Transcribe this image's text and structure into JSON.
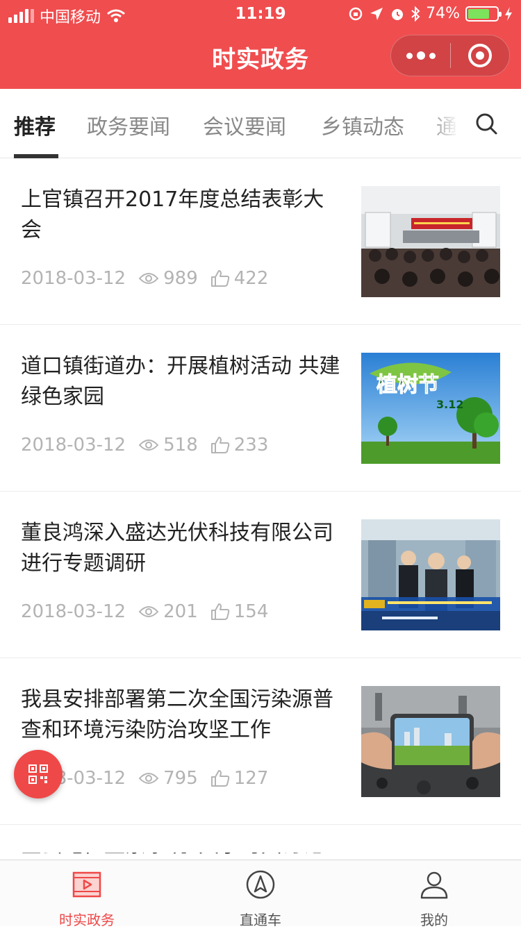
{
  "status": {
    "carrier": "中国移动",
    "time": "11:19",
    "battery": "74%",
    "battery_level": 0.74
  },
  "nav": {
    "title": "时实政务",
    "more_icon": "more-dots-icon",
    "close_icon": "target-close-icon"
  },
  "tabs": [
    {
      "label": "推荐",
      "active": true
    },
    {
      "label": "政务要闻",
      "active": false
    },
    {
      "label": "会议要闻",
      "active": false
    },
    {
      "label": "乡镇动态",
      "active": false
    },
    {
      "label": "通",
      "active": false
    }
  ],
  "news": [
    {
      "title": "上官镇召开2017年度总结表彰大会",
      "date": "2018-03-12",
      "views": "989",
      "likes": "422"
    },
    {
      "title": "道口镇街道办：开展植树活动 共建绿色家园",
      "date": "2018-03-12",
      "views": "518",
      "likes": "233",
      "thumb_text": "植树节",
      "thumb_sub": "3.12"
    },
    {
      "title": "董良鸿深入盛达光伏科技有限公司进行专题调研",
      "date": "2018-03-12",
      "views": "201",
      "likes": "154"
    },
    {
      "title": "我县安排部署第二次全国污染源普查和环境污染防治攻坚工作",
      "date": "2018-03-12",
      "views": "795",
      "likes": "127"
    }
  ],
  "peek_title": "全县纪检监察系统”大学习大讨论",
  "tabbar": [
    {
      "label": "时实政务",
      "icon": "video-icon",
      "active": true
    },
    {
      "label": "直通车",
      "icon": "navigation-icon",
      "active": false
    },
    {
      "label": "我的",
      "icon": "user-icon",
      "active": false
    }
  ],
  "colors": {
    "accent": "#f04d4f",
    "muted": "#b3b3b3"
  }
}
